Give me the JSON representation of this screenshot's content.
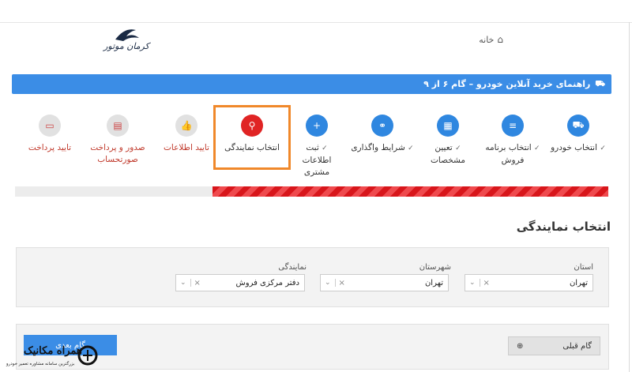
{
  "header": {
    "home_label": "خانه",
    "logo_text": "کرمان موتور"
  },
  "guide_bar": {
    "title": "راهنمای خرید آنلاین خودرو – گام ۶ از ۹"
  },
  "steps": [
    {
      "label": "انتخاب خودرو",
      "status": "done",
      "icon": "car-icon"
    },
    {
      "label": "انتخاب برنامه فروش",
      "status": "done",
      "icon": "list-icon"
    },
    {
      "label": "تعیین مشخصات",
      "status": "done",
      "icon": "calculator-icon"
    },
    {
      "label": "شرایط واگذاری",
      "status": "done",
      "icon": "handshake-icon"
    },
    {
      "label": "ثبت اطلاعات مشتری",
      "status": "done",
      "icon": "user-plus-icon"
    },
    {
      "label": "انتخاب نمایندگی",
      "status": "active",
      "icon": "map-pin-icon"
    },
    {
      "label": "تایید اطلاعات",
      "status": "pending",
      "icon": "thumbs-up-icon"
    },
    {
      "label": "صدور و پرداخت صورتحساب",
      "status": "pending",
      "icon": "invoice-icon"
    },
    {
      "label": "تایید پرداخت",
      "status": "pending",
      "icon": "credit-card-icon"
    }
  ],
  "progress": {
    "fraction": 0.667
  },
  "section_title": "انتخاب نمایندگی",
  "filters": {
    "province": {
      "label": "استان",
      "value": "تهران"
    },
    "city": {
      "label": "شهرستان",
      "value": "تهران"
    },
    "agency": {
      "label": "نمایندگی",
      "value": "دفتر مرکزی فروش"
    }
  },
  "footer": {
    "prev_label": "گام قبلی",
    "next_label": "گام بعدی"
  },
  "watermark": {
    "title": "همراه مکانیک",
    "subtitle": "بزرگترین سامانه مشاوره تعمیر خودرو"
  },
  "colors": {
    "accent": "#3b8de6",
    "active": "#e02424",
    "highlight": "#f0882a"
  }
}
